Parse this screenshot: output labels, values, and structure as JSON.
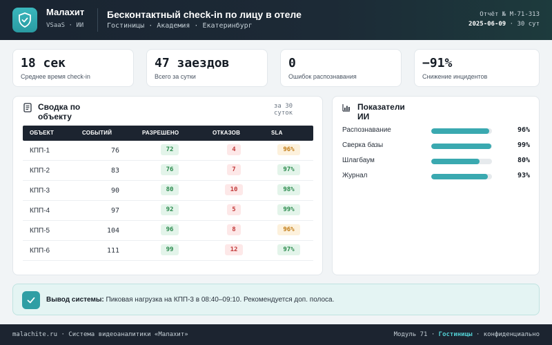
{
  "header": {
    "brand": "Малахит",
    "brand_sub": "VSaaS · ИИ",
    "title": "Бесконтактный check-in по лицу в отеле",
    "subtitle": "Гостиницы · Академия · Екатеринбург",
    "report_line1": "Отчёт № М-71-313",
    "report_date": "2025-06-09",
    "report_period": " · 30 сут"
  },
  "kpis": [
    {
      "value": "18 сек",
      "label": "Среднее время check-in"
    },
    {
      "value": "47 заездов",
      "label": "Всего за сутки"
    },
    {
      "value": "0",
      "label": "Ошибок распознавания"
    },
    {
      "value": "−91%",
      "label": "Снижение инцидентов"
    }
  ],
  "summary": {
    "title_l1": "Сводка по",
    "title_l2": "объекту",
    "period_l1": "за 30",
    "period_l2": "суток",
    "columns": [
      "ОБЪЕКТ",
      "СОБЫТИЙ",
      "РАЗРЕШЕНО",
      "ОТКАЗОВ",
      "SLA"
    ],
    "rows": [
      {
        "object": "КПП-1",
        "events": "76",
        "allowed": "72",
        "denied": "4",
        "sla": "96%"
      },
      {
        "object": "КПП-2",
        "events": "83",
        "allowed": "76",
        "denied": "7",
        "sla": "97%"
      },
      {
        "object": "КПП-3",
        "events": "90",
        "allowed": "80",
        "denied": "10",
        "sla": "98%"
      },
      {
        "object": "КПП-4",
        "events": "97",
        "allowed": "92",
        "denied": "5",
        "sla": "99%"
      },
      {
        "object": "КПП-5",
        "events": "104",
        "allowed": "96",
        "denied": "8",
        "sla": "96%"
      },
      {
        "object": "КПП-6",
        "events": "111",
        "allowed": "99",
        "denied": "12",
        "sla": "97%"
      }
    ]
  },
  "ai": {
    "title_l1": "Показатели",
    "title_l2": "ИИ",
    "metrics": [
      {
        "label": "Распознавание",
        "value": 96,
        "display": "96%"
      },
      {
        "label": "Сверка базы",
        "value": 99,
        "display": "99%"
      },
      {
        "label": "Шлагбаум",
        "value": 80,
        "display": "80%"
      },
      {
        "label": "Журнал",
        "value": 93,
        "display": "93%"
      }
    ]
  },
  "system": {
    "label": "Вывод системы:",
    "text": " Пиковая нагрузка на КПП-3 в 08:40–09:10. Рекомендуется доп. полоса."
  },
  "footer": {
    "left": "malachite.ru · Система видеоаналитики «Малахит»",
    "module": "Модуль 71 ·",
    "accent": "Гостиницы",
    "right": "· конфиденциально"
  },
  "colors": {
    "accent": "#3aa9b0",
    "header_bg": "#1c2430",
    "ok": "#2a8a4c",
    "bad": "#c23b3b",
    "warn": "#c07a12"
  }
}
